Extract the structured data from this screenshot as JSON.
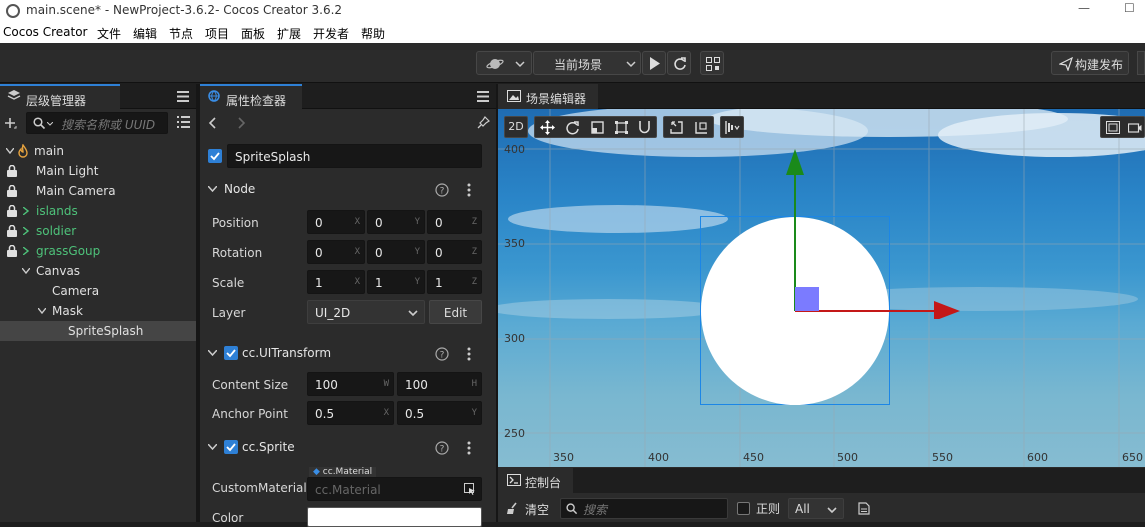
{
  "window": {
    "title": "main.scene* - NewProject-3.6.2- Cocos Creator 3.6.2",
    "minimize_glyph": "—",
    "maximize_glyph": "☐"
  },
  "menu": [
    "Cocos Creator",
    "文件",
    "编辑",
    "节点",
    "项目",
    "面板",
    "扩展",
    "开发者",
    "帮助"
  ],
  "toolbar": {
    "scene_select": "当前场景",
    "build_label": "构建发布"
  },
  "hierarchy": {
    "tab": "层级管理器",
    "search_placeholder": "搜索名称或 UUID",
    "items": [
      {
        "label": "main",
        "color": "#e0e0e0"
      },
      {
        "label": "Main Light",
        "color": "#e0e0e0"
      },
      {
        "label": "Main Camera",
        "color": "#e0e0e0"
      },
      {
        "label": "islands",
        "color": "#4ec27a"
      },
      {
        "label": "soldier",
        "color": "#4ec27a"
      },
      {
        "label": "grassGoup",
        "color": "#4ec27a"
      },
      {
        "label": "Canvas",
        "color": "#e0e0e0"
      },
      {
        "label": "Camera",
        "color": "#e0e0e0"
      },
      {
        "label": "Mask",
        "color": "#e0e0e0"
      },
      {
        "label": "SpriteSplash",
        "color": "#e0e0e0"
      }
    ]
  },
  "inspector": {
    "tab": "属性检查器",
    "node_name": "SpriteSplash",
    "node_section": "Node",
    "position": {
      "label": "Position",
      "x": "0",
      "y": "0",
      "z": "0"
    },
    "rotation": {
      "label": "Rotation",
      "x": "0",
      "y": "0",
      "z": "0"
    },
    "scale": {
      "label": "Scale",
      "x": "1",
      "y": "1",
      "z": "1"
    },
    "layer": {
      "label": "Layer",
      "value": "UI_2D",
      "edit": "Edit"
    },
    "axis": {
      "x": "X",
      "y": "Y",
      "z": "Z",
      "w": "W",
      "h": "H"
    },
    "uitransform": {
      "title": "cc.UITransform",
      "content_size_label": "Content Size",
      "width": "100",
      "height": "100",
      "anchor_label": "Anchor Point",
      "anchor_x": "0.5",
      "anchor_y": "0.5"
    },
    "sprite": {
      "title": "cc.Sprite",
      "material_label": "CustomMaterial",
      "material_tag": "cc.Material",
      "material_placeholder": "cc.Material",
      "color_label": "Color"
    }
  },
  "scene": {
    "tab": "场景编辑器",
    "mode_2d": "2D",
    "y_ticks": [
      "400",
      "350",
      "300",
      "250"
    ],
    "x_ticks": [
      "350",
      "400",
      "450",
      "500",
      "550",
      "600",
      "650"
    ],
    "colors": {
      "x_axis": "#c41818",
      "y_axis": "#1a8a1a",
      "sprite": "#ffffff",
      "pivot": "#7b7bff"
    }
  },
  "console": {
    "tab": "控制台",
    "clear": "清空",
    "search_placeholder": "搜索",
    "regex_label": "正则",
    "level": "All"
  }
}
